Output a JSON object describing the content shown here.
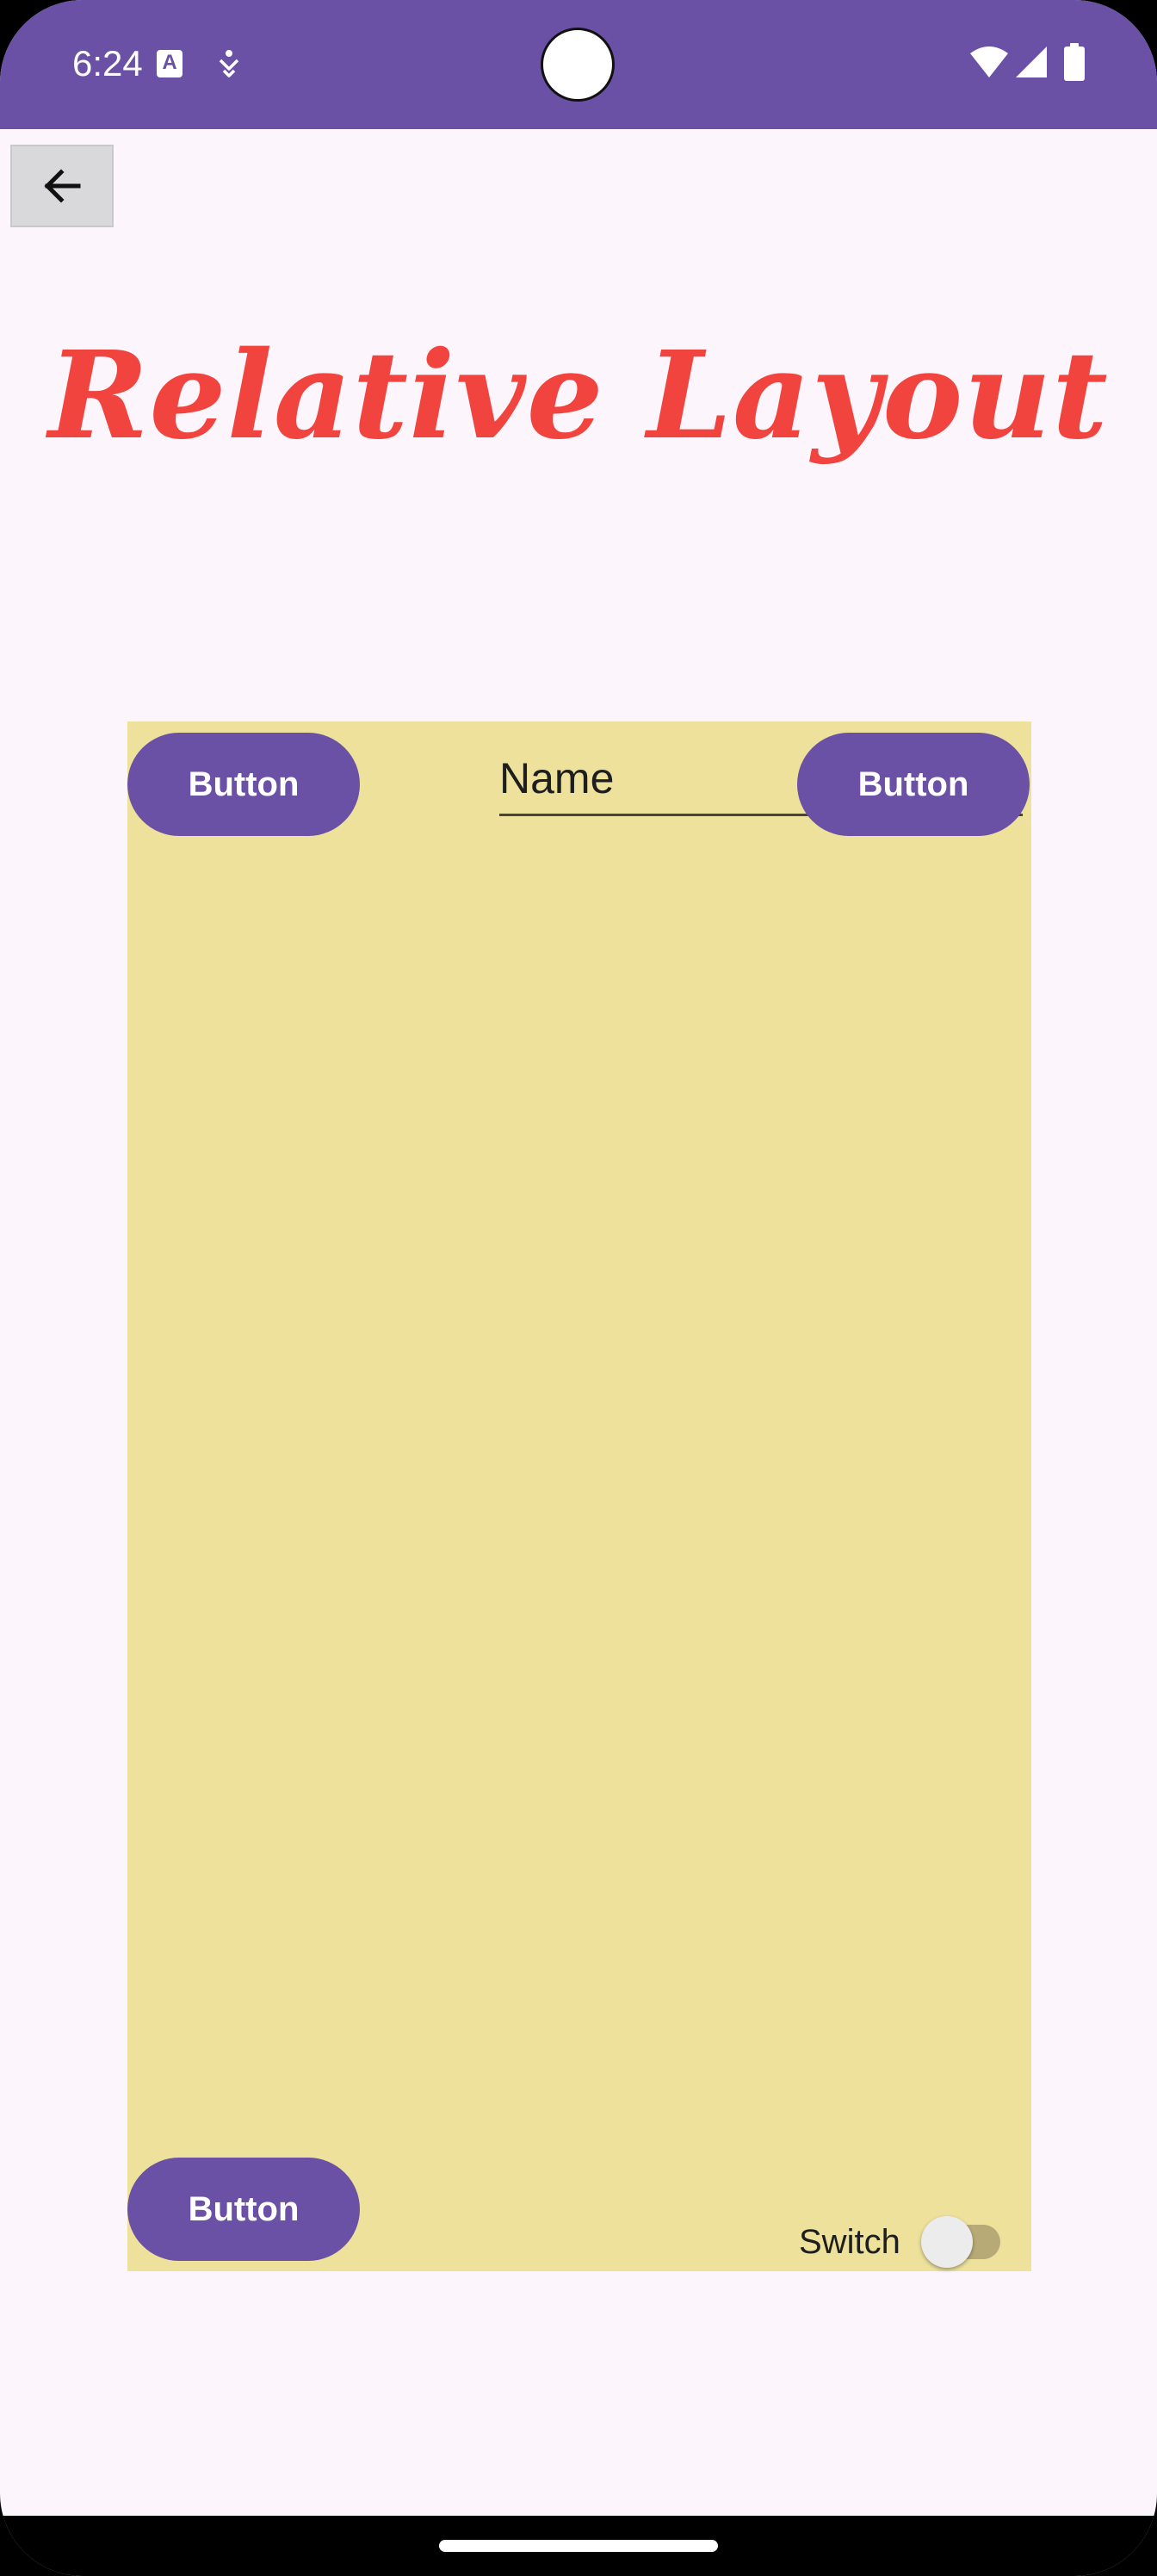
{
  "status_bar": {
    "time": "6:24",
    "a_icon_letter": "A",
    "icons": [
      "a-notification-icon",
      "accessibility-icon",
      "wifi-icon",
      "signal-icon",
      "battery-icon"
    ],
    "background_color": "#6A51A6"
  },
  "toolbar": {
    "back_icon": "arrow-left-icon"
  },
  "page": {
    "title": "Relative Layout",
    "title_color": "#F2443E",
    "background_color": "#FCF5FC"
  },
  "relative_layout": {
    "background_color": "#EEE19C",
    "button_top_left": "Button",
    "button_top_right": "Button",
    "button_bottom_left": "Button",
    "button_color": "#6A51A6",
    "name_field": {
      "value": "Name"
    },
    "switch": {
      "label": "Switch",
      "checked": false
    }
  }
}
